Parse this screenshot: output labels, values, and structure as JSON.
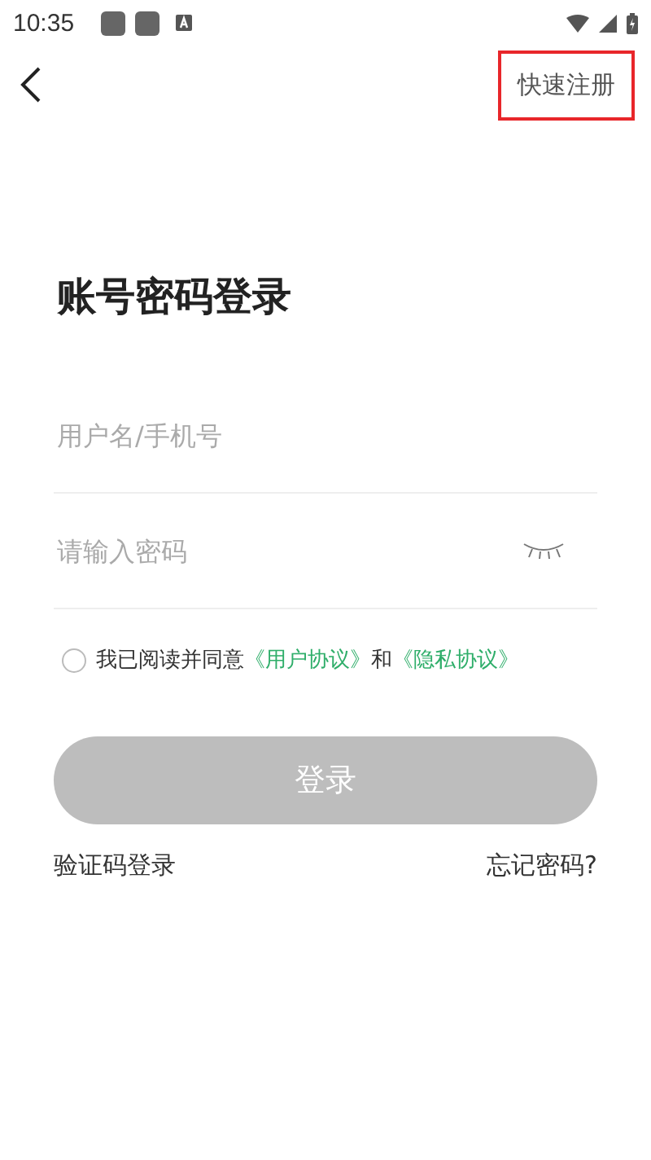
{
  "status_bar": {
    "time": "10:35"
  },
  "nav": {
    "register": {
      "label": "快速注册",
      "highlighted": true
    }
  },
  "title": "账号密码登录",
  "fields": [
    {
      "kind": "text",
      "placeholder": "用户名/手机号"
    },
    {
      "kind": "password",
      "placeholder": "请输入密码",
      "revealed": false
    }
  ],
  "agreement": {
    "checked": false,
    "text": "我已阅读并同意",
    "links": [
      "《用户协议》",
      "《隐私协议》"
    ],
    "joiner": "和"
  },
  "login_button": {
    "label": "登录",
    "disabled": true
  },
  "bottom_links": [
    "验证码登录",
    "忘记密码?"
  ]
}
